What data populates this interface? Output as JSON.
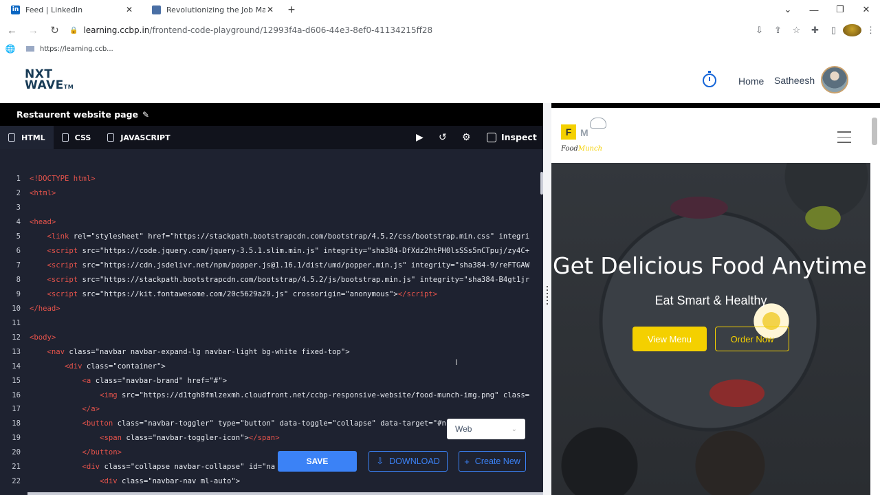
{
  "browser": {
    "tabs": [
      {
        "title": "Feed | LinkedIn",
        "favicon": "in",
        "color": "#0a66c2"
      },
      {
        "title": "Revolutionizing the Job Market",
        "favicon": "",
        "color": "#4a6fa5"
      }
    ],
    "url_host": "learning.ccbp.in",
    "url_path": "/frontend-code-playground/12993f4a-d606-44e3-8ef0-41134215ff28",
    "bookmark": "https://learning.ccb..."
  },
  "app": {
    "logo_top": "NXT",
    "logo_bottom": "WAVE",
    "logo_tm": "TM",
    "home": "Home",
    "user": "Satheesh"
  },
  "editor": {
    "title": "Restaurent website page",
    "tabs": [
      "HTML",
      "CSS",
      "JAVASCRIPT"
    ],
    "inspect": "Inspect",
    "select_value": "Web",
    "save": "SAVE",
    "download": "DOWNLOAD",
    "create": "Create New",
    "lines": [
      {
        "n": "1",
        "html": "<span class='tg'>&lt;!DOCTYPE html&gt;</span>"
      },
      {
        "n": "2",
        "html": "<span class='tg'>&lt;html&gt;</span>"
      },
      {
        "n": "3",
        "html": ""
      },
      {
        "n": "4",
        "html": "<span class='tg'>&lt;head&gt;</span>"
      },
      {
        "n": "5",
        "html": "    <span class='tg'>&lt;link</span> rel=\"stylesheet\" href=\"https://stackpath.bootstrapcdn.com/bootstrap/4.5.2/css/bootstrap.min.css\" integri"
      },
      {
        "n": "6",
        "html": "    <span class='tg'>&lt;script</span> src=\"https://code.jquery.com/jquery-3.5.1.slim.min.js\" integrity=\"sha384-DfXdz2htPH0lsSSs5nCTpuj/zy4C+"
      },
      {
        "n": "7",
        "html": "    <span class='tg'>&lt;script</span> src=\"https://cdn.jsdelivr.net/npm/popper.js@1.16.1/dist/umd/popper.min.js\" integrity=\"sha384-9/reFTGAW"
      },
      {
        "n": "8",
        "html": "    <span class='tg'>&lt;script</span> src=\"https://stackpath.bootstrapcdn.com/bootstrap/4.5.2/js/bootstrap.min.js\" integrity=\"sha384-B4gt1jr"
      },
      {
        "n": "9",
        "html": "    <span class='tg'>&lt;script</span> src=\"https://kit.fontawesome.com/20c5629a29.js\" crossorigin=\"anonymous\"&gt;<span class='tg'>&lt;/script&gt;</span>"
      },
      {
        "n": "10",
        "html": "<span class='tg'>&lt;/head&gt;</span>"
      },
      {
        "n": "11",
        "html": ""
      },
      {
        "n": "12",
        "html": "<span class='tg'>&lt;body&gt;</span>"
      },
      {
        "n": "13",
        "html": "    <span class='tg'>&lt;nav</span> class=\"navbar navbar-expand-lg navbar-light bg-white fixed-top\"&gt;"
      },
      {
        "n": "14",
        "html": "        <span class='tg'>&lt;div</span> class=\"container\"&gt;"
      },
      {
        "n": "15",
        "html": "            <span class='tg'>&lt;a</span> class=\"navbar-brand\" href=\"#\"&gt;"
      },
      {
        "n": "16",
        "html": "                <span class='tg'>&lt;img</span> src=\"https://d1tgh8fmlzexmh.cloudfront.net/ccbp-responsive-website/food-munch-img.png\" class="
      },
      {
        "n": "17",
        "html": "            <span class='tg'>&lt;/a&gt;</span>"
      },
      {
        "n": "18",
        "html": "            <span class='tg'>&lt;button</span> class=\"navbar-toggler\" type=\"button\" data-toggle=\"collapse\" data-target=\"#n"
      },
      {
        "n": "19",
        "html": "                <span class='tg'>&lt;span</span> class=\"navbar-toggler-icon\"&gt;<span class='tg'>&lt;/span&gt;</span>"
      },
      {
        "n": "20",
        "html": "            <span class='tg'>&lt;/button&gt;</span>"
      },
      {
        "n": "21",
        "html": "            <span class='tg'>&lt;div</span> class=\"collapse navbar-collapse\" id=\"na"
      },
      {
        "n": "22",
        "html": "                <span class='tg'>&lt;div</span> class=\"navbar-nav ml-auto\"&gt;"
      }
    ]
  },
  "preview": {
    "logo_name_a": "Food",
    "logo_name_b": "Munch",
    "heading": "Get Delicious Food Anytime",
    "subheading": "Eat Smart & Healthy",
    "view_menu": "View Menu",
    "order_now": "Order Now",
    "accent": "#f4d000"
  }
}
